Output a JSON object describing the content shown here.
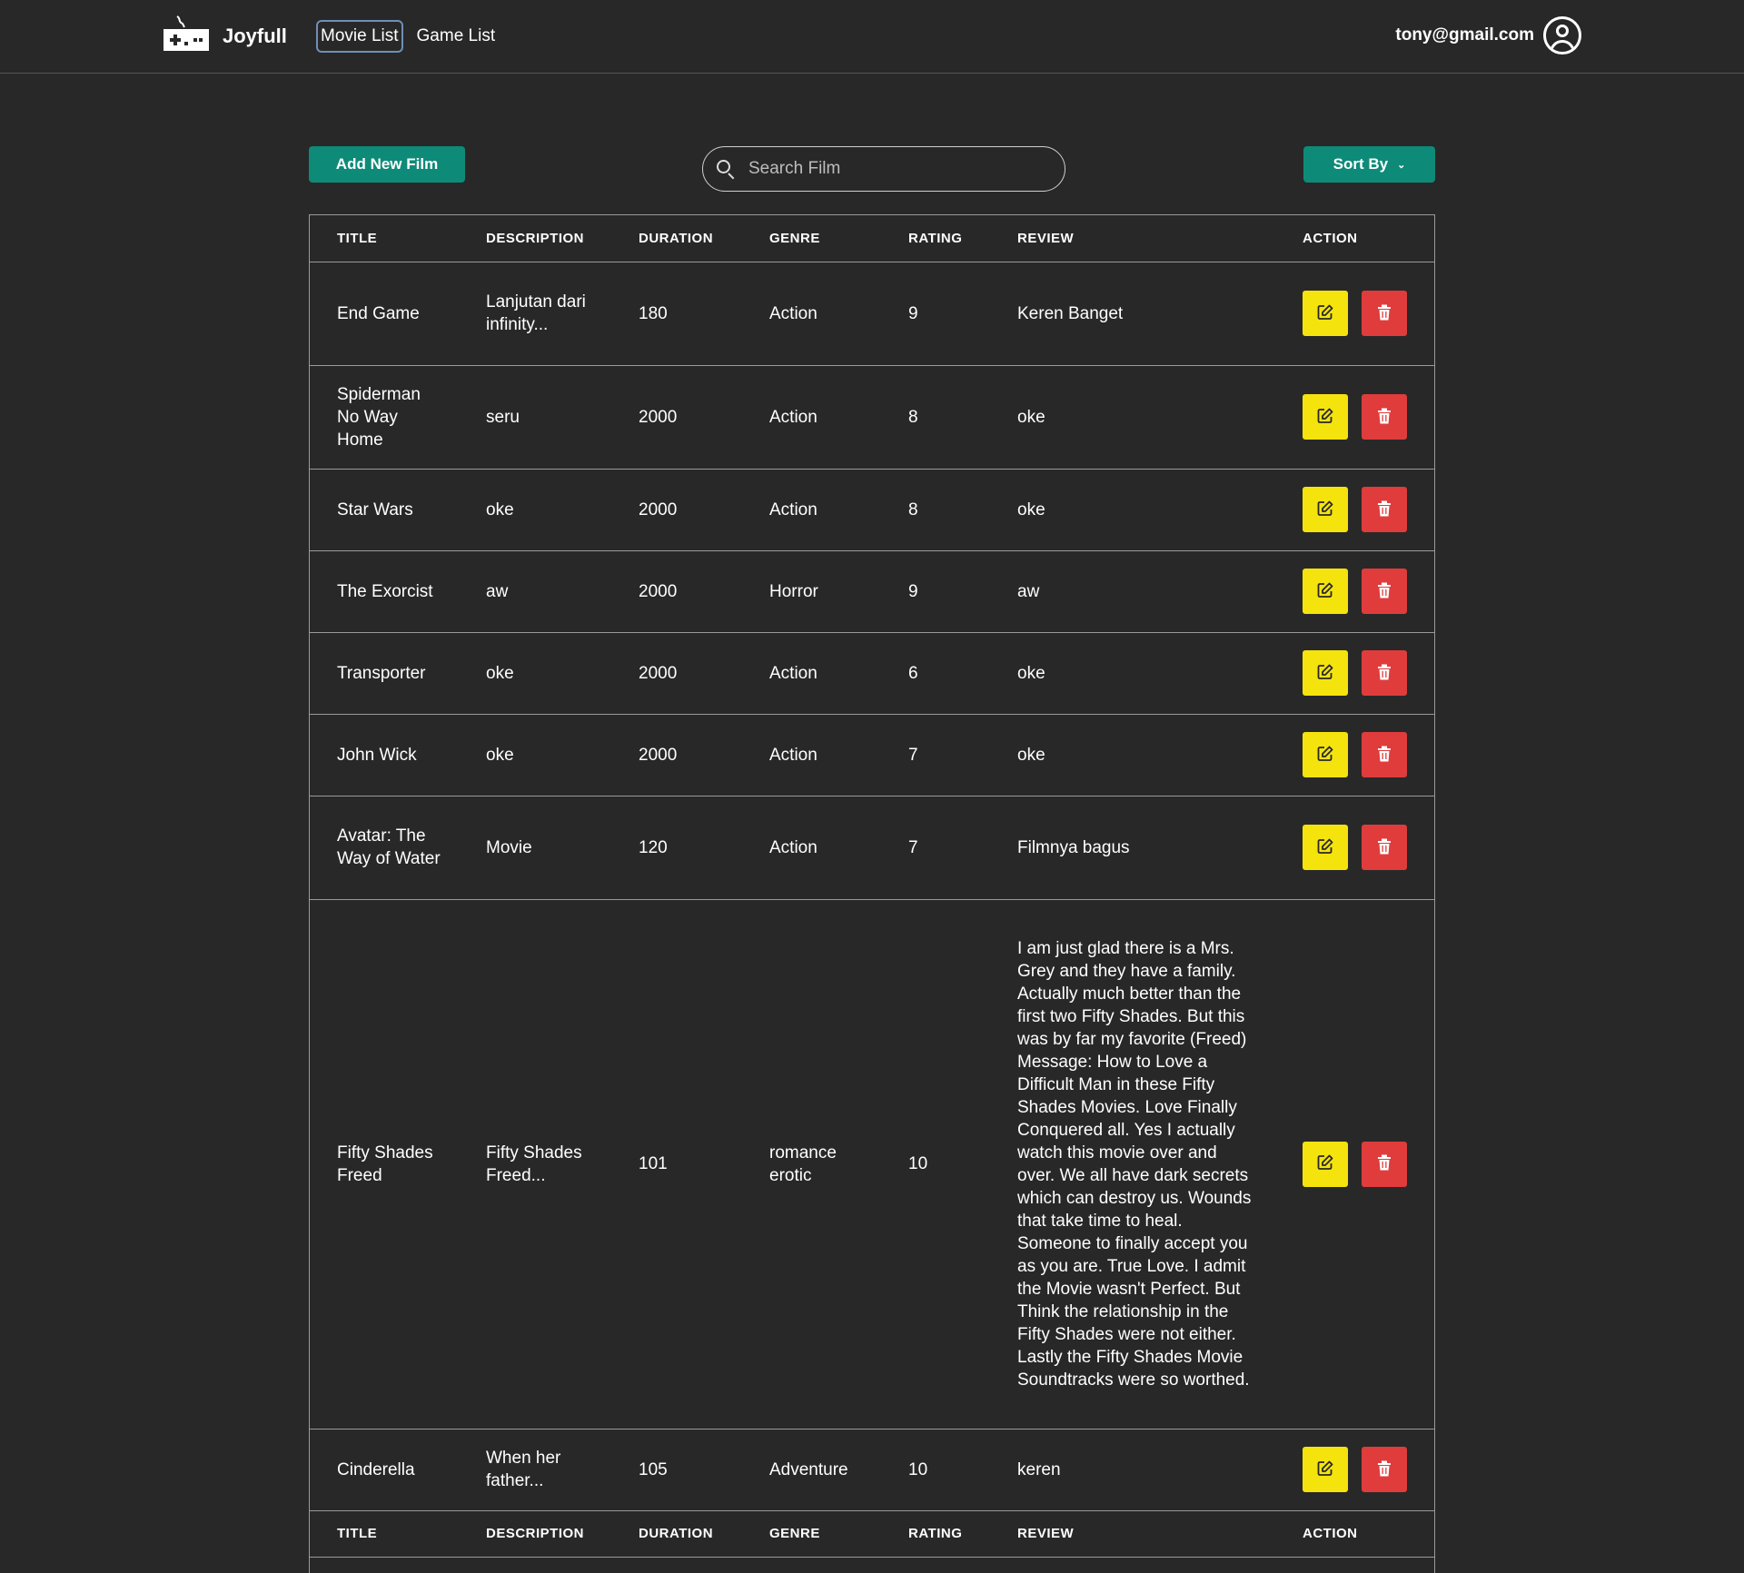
{
  "nav": {
    "brand": "Joyfull",
    "links": [
      "Movie List",
      "Game List"
    ],
    "user_email": "tony@gmail.com"
  },
  "toolbar": {
    "add_label": "Add New Film",
    "search_placeholder": "Search Film",
    "sort_label": "Sort By"
  },
  "table": {
    "headers": [
      "TITLE",
      "DESCRIPTION",
      "DURATION",
      "GENRE",
      "RATING",
      "REVIEW",
      "ACTION"
    ],
    "rows": [
      {
        "title": "End Game",
        "description": "Lanjutan dari infinity...",
        "duration": "180",
        "genre": "Action",
        "rating": "9",
        "review": "Keren Banget"
      },
      {
        "title": "Spiderman No Way Home",
        "description": "seru",
        "duration": "2000",
        "genre": "Action",
        "rating": "8",
        "review": "oke"
      },
      {
        "title": "Star Wars",
        "description": "oke",
        "duration": "2000",
        "genre": "Action",
        "rating": "8",
        "review": "oke"
      },
      {
        "title": "The Exorcist",
        "description": "aw",
        "duration": "2000",
        "genre": "Horror",
        "rating": "9",
        "review": "aw"
      },
      {
        "title": "Transporter",
        "description": "oke",
        "duration": "2000",
        "genre": "Action",
        "rating": "6",
        "review": "oke"
      },
      {
        "title": "John Wick",
        "description": "oke",
        "duration": "2000",
        "genre": "Action",
        "rating": "7",
        "review": "oke"
      },
      {
        "title": "Avatar: The Way of Water",
        "description": "Movie",
        "duration": "120",
        "genre": "Action",
        "rating": "7",
        "review": "Filmnya bagus"
      },
      {
        "title": "Fifty Shades Freed",
        "description": "Fifty Shades Freed...",
        "duration": "101",
        "genre": "romance erotic",
        "rating": "10",
        "review": "I am just glad there is a Mrs. Grey and they have a family. Actually much better than the first two Fifty Shades. But this was by far my favorite (Freed) Message: How to Love a Difficult Man in these Fifty Shades Movies. Love Finally Conquered all. Yes I actually watch this movie over and over. We all have dark secrets which can destroy us. Wounds that take time to heal. Someone to finally accept you as you are. True Love. I admit the Movie wasn't Perfect. But Think the relationship in the Fifty Shades were not either. Lastly the Fifty Shades Movie Soundtracks were so worthed."
      },
      {
        "title": "Cinderella",
        "description": "When her father...",
        "duration": "105",
        "genre": "Adventure",
        "rating": "10",
        "review": "keren"
      }
    ]
  },
  "colors": {
    "background": "#282828",
    "primary": "#0e8a78",
    "edit": "#f5e30e",
    "delete": "#e03c3c"
  },
  "icons": {
    "brand": "gamepad-icon",
    "search": "search-icon",
    "sort": "chevron-down-icon",
    "edit": "edit-icon",
    "delete": "trash-icon",
    "user": "user-avatar-icon"
  }
}
